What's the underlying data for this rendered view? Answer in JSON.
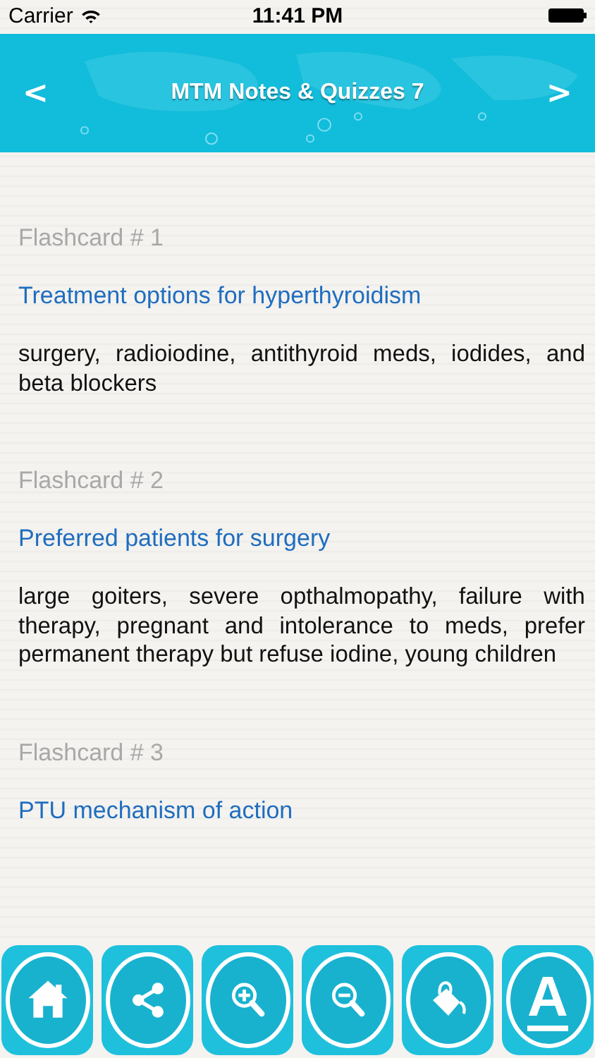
{
  "status_bar": {
    "carrier": "Carrier",
    "time": "11:41 PM"
  },
  "header": {
    "title": "MTM Notes & Quizzes 7",
    "back": "<",
    "forward": ">"
  },
  "flashcards": [
    {
      "label": "Flashcard # 1",
      "title": "Treatment options for hyperthyroidism",
      "body": "surgery, radioiodine, antithyroid meds, iodides, and beta blockers"
    },
    {
      "label": "Flashcard # 2",
      "title": "Preferred patients for surgery",
      "body": "large goiters, severe opthalmopathy, failure with therapy, pregnant and intolerance to meds, prefer permanent therapy but refuse iodine, young children"
    },
    {
      "label": "Flashcard # 3",
      "title": "PTU mechanism of action"
    }
  ],
  "toolbar": [
    {
      "kind": "home"
    },
    {
      "kind": "share"
    },
    {
      "kind": "zoom_in"
    },
    {
      "kind": "zoom_out"
    },
    {
      "kind": "paint"
    },
    {
      "kind": "font",
      "glyph": "A"
    }
  ]
}
